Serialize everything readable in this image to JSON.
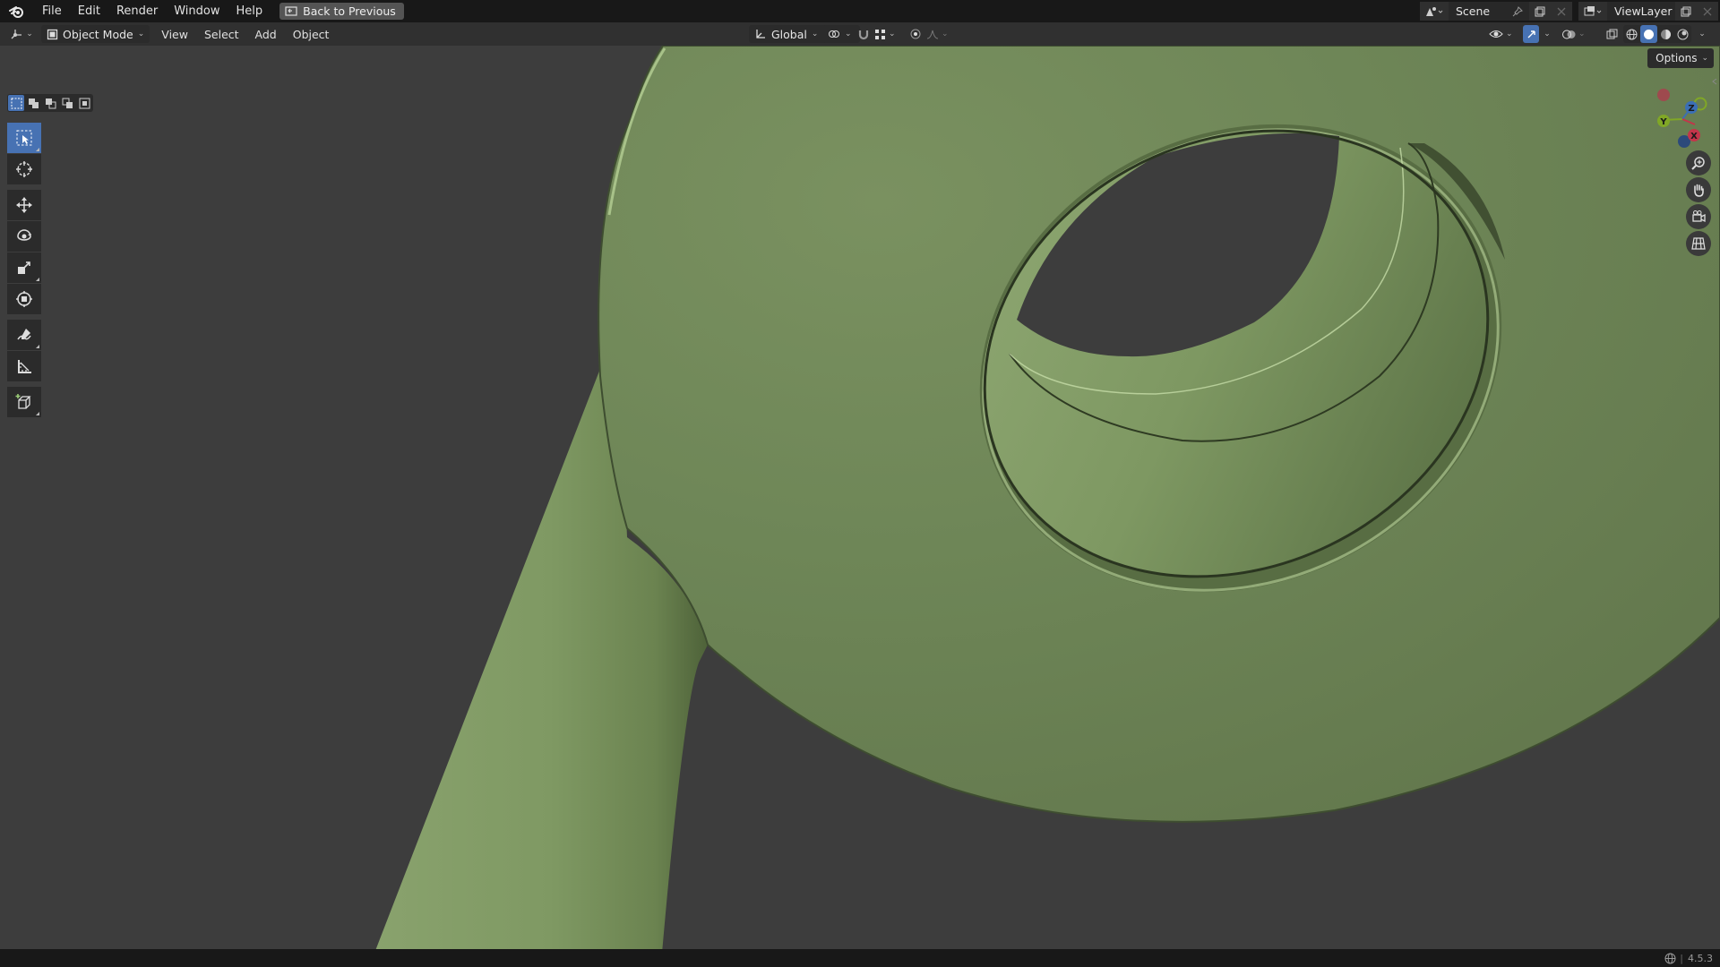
{
  "menu": {
    "file": "File",
    "edit": "Edit",
    "render": "Render",
    "window": "Window",
    "help": "Help",
    "back_button": "Back to Previous"
  },
  "scene": {
    "name": "Scene"
  },
  "view_layer": {
    "name": "ViewLayer"
  },
  "header": {
    "mode": "Object Mode",
    "view": "View",
    "select": "Select",
    "add": "Add",
    "object": "Object",
    "transform_orientation": "Global"
  },
  "options_label": "Options",
  "gizmo": {
    "x": "X",
    "y": "Y",
    "z": "Z"
  },
  "status": {
    "version": "4.5.3"
  },
  "colors": {
    "model_green": "#6f8657",
    "viewport_bg": "#3d3d3d",
    "accent_blue": "#4772b3",
    "axis_x": "#c3354a",
    "axis_y": "#80a726",
    "axis_z": "#3b6fb5"
  }
}
